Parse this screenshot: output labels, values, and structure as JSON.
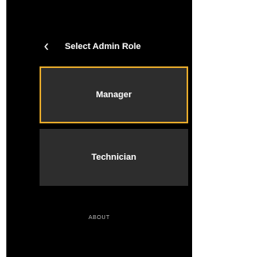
{
  "header": {
    "back_icon": "chevron-left-icon",
    "title": "Select Admin Role"
  },
  "roles": [
    {
      "label": "Manager",
      "selected": true
    },
    {
      "label": "Technician",
      "selected": false
    }
  ],
  "footer": {
    "about_label": "ABOUT"
  },
  "colors": {
    "background": "#000000",
    "card": "#2d2d2d",
    "selection_border": "#e5a92b",
    "text": "#ffffff",
    "muted_text": "#b8b8b8"
  }
}
